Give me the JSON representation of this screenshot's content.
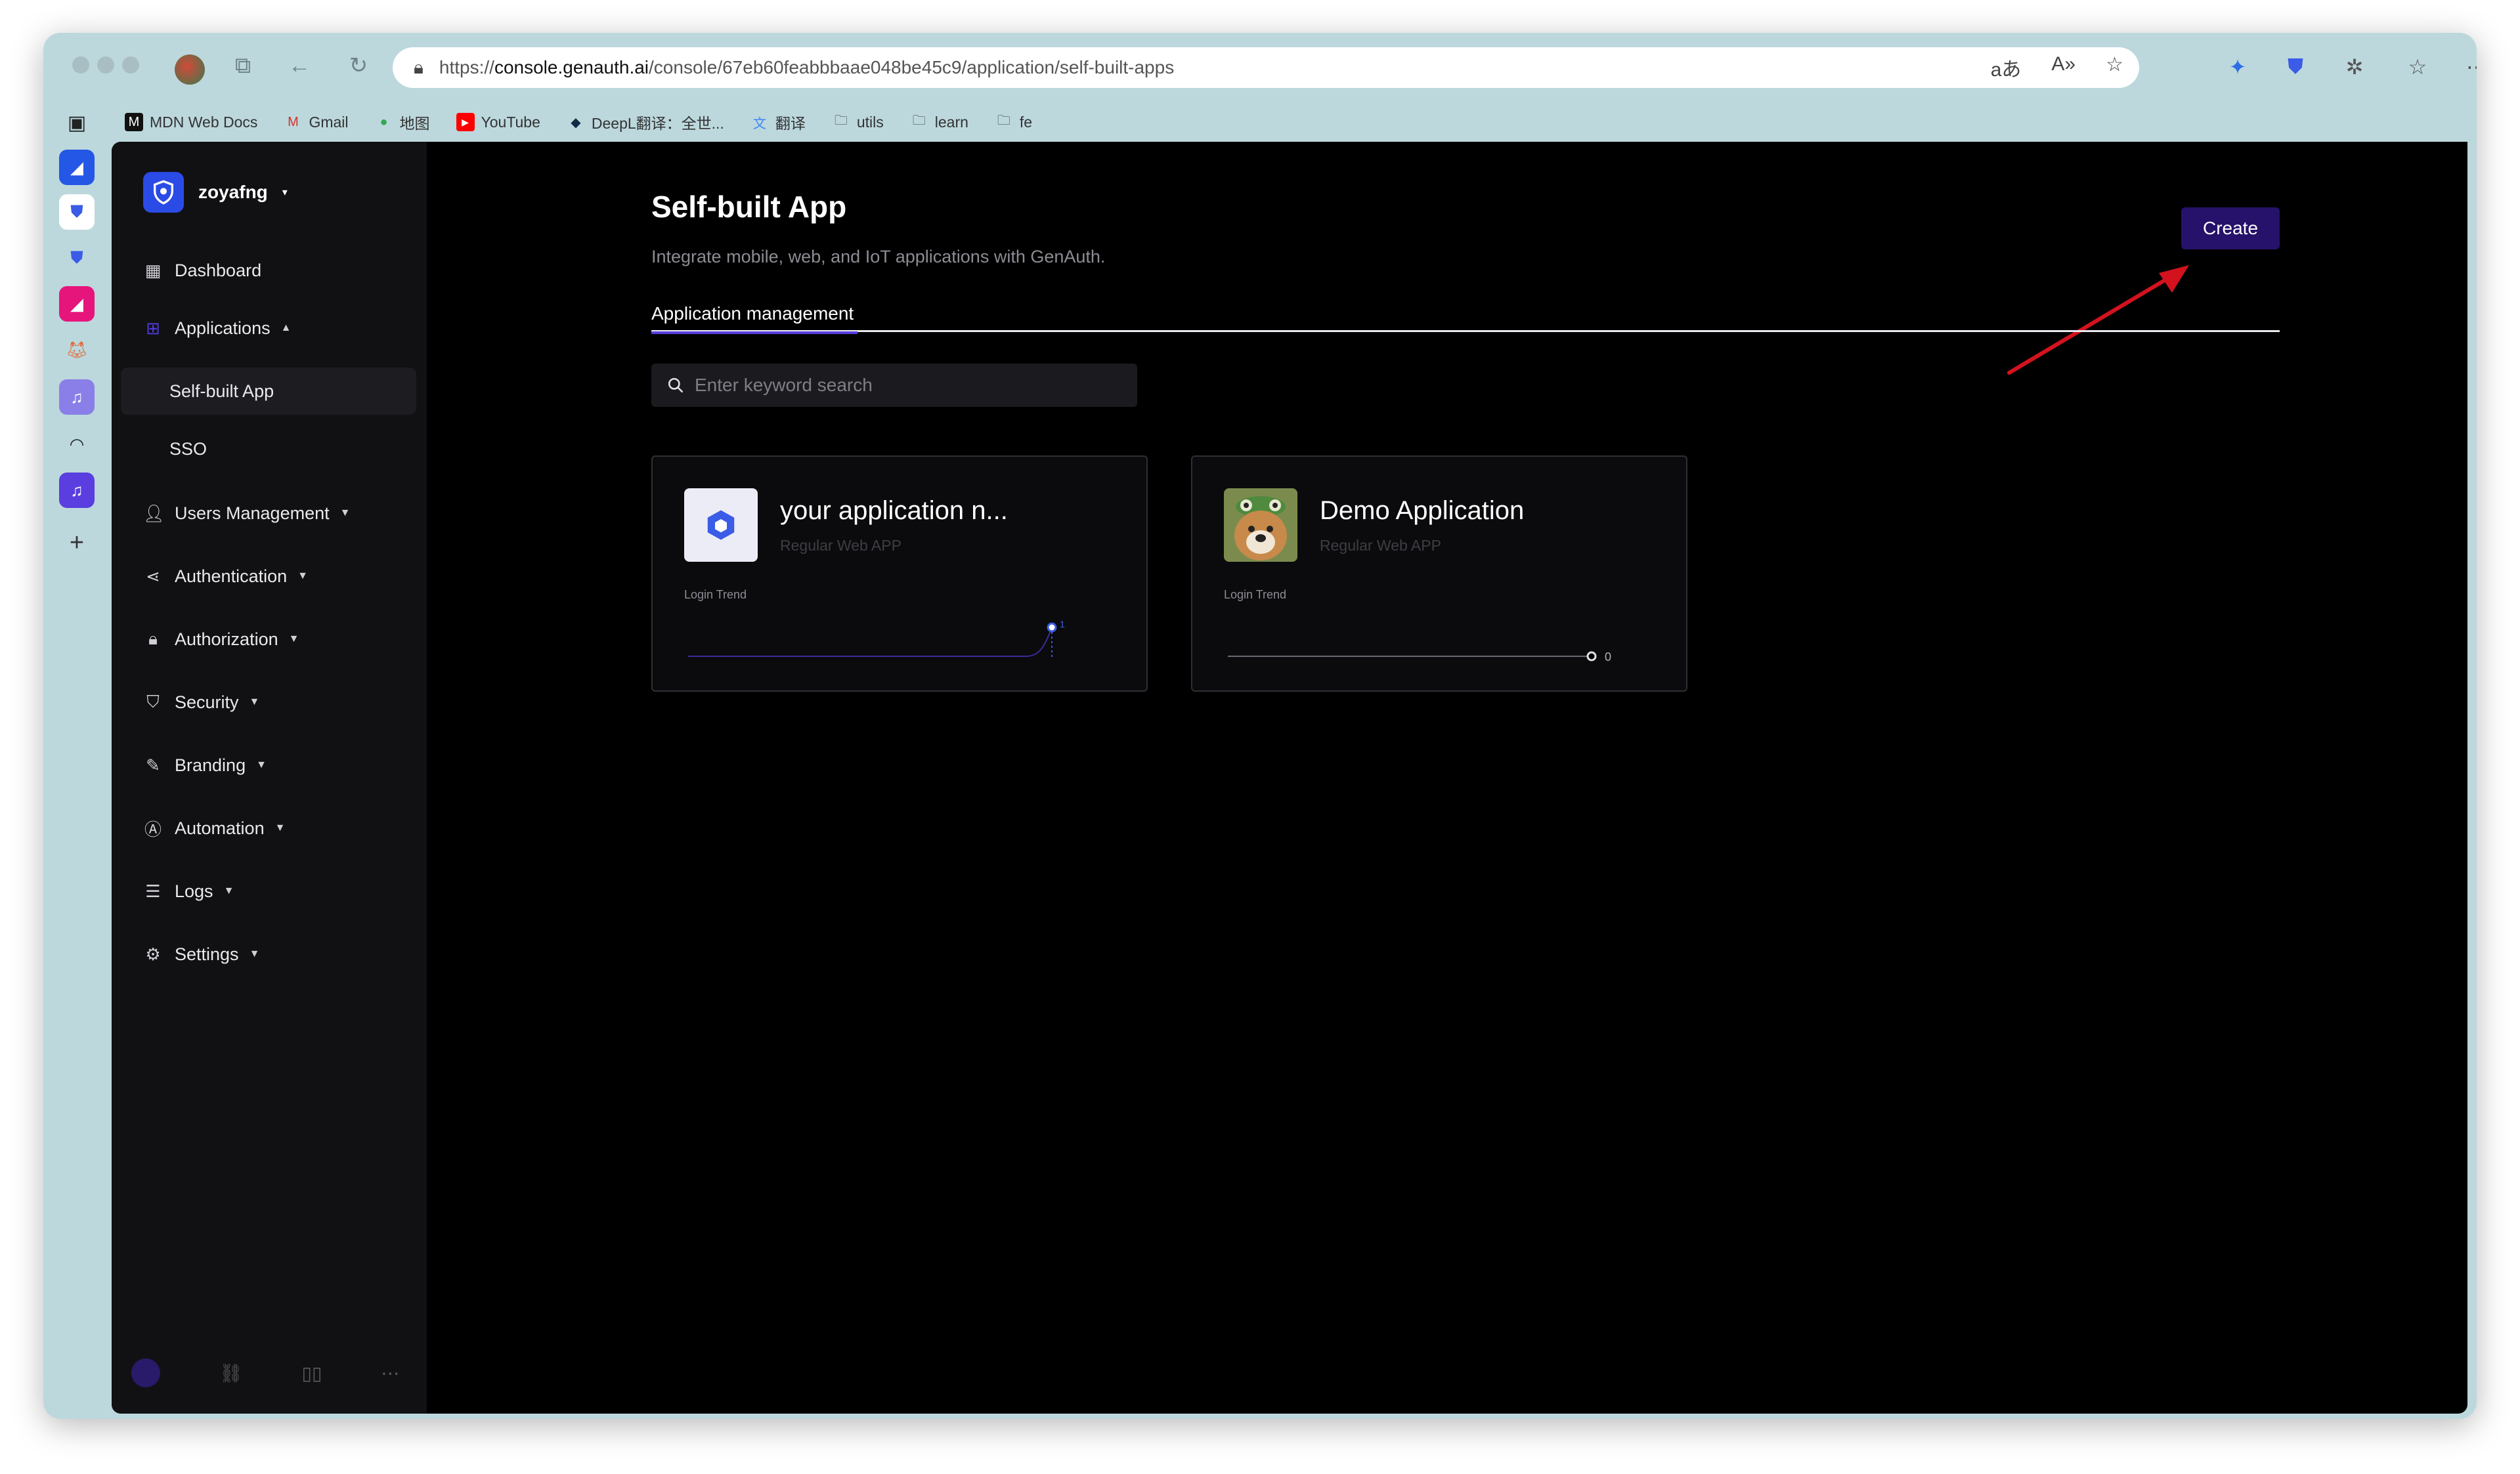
{
  "browser": {
    "url_prefix": "https://",
    "url_host": "console.genauth.ai",
    "url_path": "/console/67eb60feabbbaae048be45c9/application/self-built-apps",
    "bookmarks": [
      {
        "label": "MDN Web Docs",
        "icon": "mdn-icon"
      },
      {
        "label": "Gmail",
        "icon": "gmail-icon"
      },
      {
        "label": "地图",
        "icon": "maps-icon"
      },
      {
        "label": "YouTube",
        "icon": "youtube-icon"
      },
      {
        "label": "DeepL翻译：全世...",
        "icon": "deepl-icon"
      },
      {
        "label": "翻译",
        "icon": "translate-icon"
      },
      {
        "label": "utils",
        "icon": "folder-icon"
      },
      {
        "label": "learn",
        "icon": "folder-icon"
      },
      {
        "label": "fe",
        "icon": "folder-icon"
      }
    ]
  },
  "sidebar": {
    "org_name": "zoyafng",
    "items": [
      {
        "label": "Dashboard"
      },
      {
        "label": "Applications"
      },
      {
        "label": "Self-built App"
      },
      {
        "label": "SSO"
      },
      {
        "label": "Users Management"
      },
      {
        "label": "Authentication"
      },
      {
        "label": "Authorization"
      },
      {
        "label": "Security"
      },
      {
        "label": "Branding"
      },
      {
        "label": "Automation"
      },
      {
        "label": "Logs"
      },
      {
        "label": "Settings"
      }
    ]
  },
  "main": {
    "title": "Self-built App",
    "subtitle": "Integrate mobile, web, and IoT applications with GenAuth.",
    "create_label": "Create",
    "tab_label": "Application management",
    "search_placeholder": "Enter keyword search"
  },
  "cards": [
    {
      "name": "your application n...",
      "type": "Regular Web APP",
      "trend_label": "Login Trend",
      "last_value": "1"
    },
    {
      "name": "Demo Application",
      "type": "Regular Web APP",
      "trend_label": "Login Trend",
      "last_value": "0"
    }
  ],
  "colors": {
    "accent": "#5a3ee0",
    "create_button": "#26126a",
    "annotation_arrow": "#d4121e"
  }
}
